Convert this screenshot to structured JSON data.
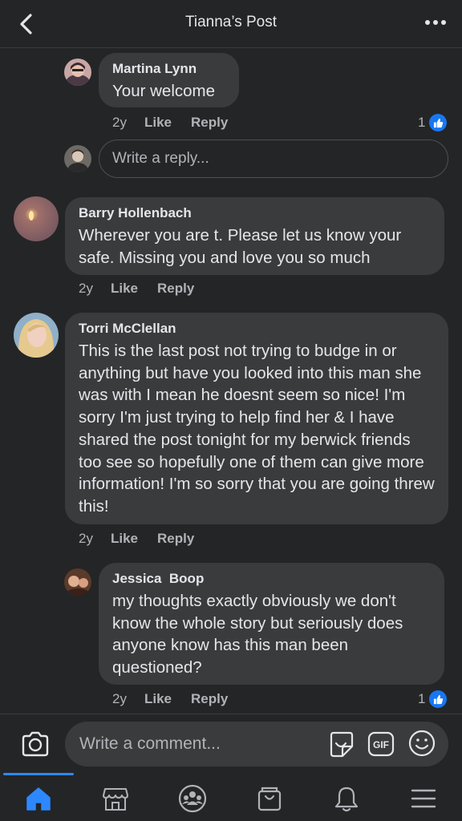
{
  "header": {
    "title": "Tianna’s Post"
  },
  "comments": [
    {
      "name": "Martina Lynn",
      "text": "Your welcome",
      "time": "2y",
      "like": "Like",
      "reply": "Reply",
      "reaction_count": "1"
    },
    {
      "name": "Barry Hollenbach",
      "text": "Wherever you are t. Please let us know your safe. Missing you and love you so much",
      "time": "2y",
      "like": "Like",
      "reply": "Reply"
    },
    {
      "name": "Torri McClellan",
      "text": "This is the last post not trying to budge in or anything but have you looked into this man she was with I mean he doesnt seem so nice! I'm sorry I'm just trying to help find her & I have shared the post tonight for my berwick friends too see so hopefully one of them can give more information! I'm so sorry that you are going threw this!",
      "time": "2y",
      "like": "Like",
      "reply": "Reply"
    },
    {
      "name": "Jessica  Boop",
      "text": "my thoughts exactly obviously we don't know the whole story but seriously does anyone know has this man been questioned?",
      "time": "2y",
      "like": "Like",
      "reply": "Reply",
      "reaction_count": "1"
    }
  ],
  "reply_box": {
    "placeholder": "Write a reply..."
  },
  "composer": {
    "placeholder": "Write a comment...",
    "gif_label": "GIF"
  },
  "tabs": [
    "home-icon",
    "marketplace-icon",
    "groups-icon",
    "shop-icon",
    "notifications-bell-icon",
    "menu-icon"
  ],
  "colors": {
    "accent": "#2d88ff",
    "bubble": "#3a3b3c",
    "background": "#242526",
    "like_blue": "#1877f2"
  }
}
